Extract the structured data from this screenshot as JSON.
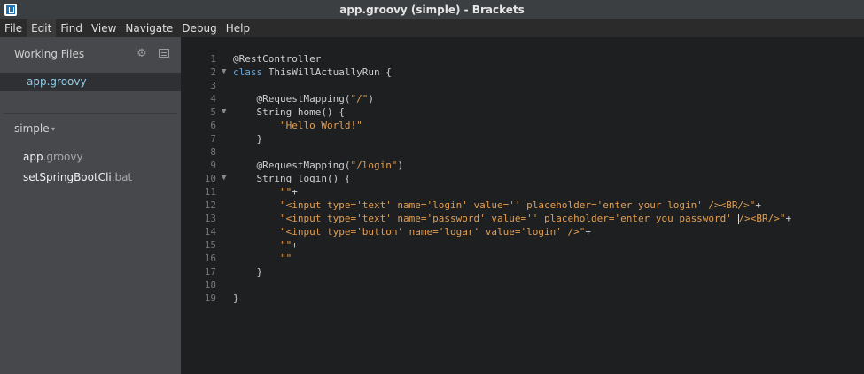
{
  "window": {
    "title": "app.groovy (simple) - Brackets"
  },
  "menu": [
    "File",
    "Edit",
    "Find",
    "View",
    "Navigate",
    "Debug",
    "Help"
  ],
  "sidebar": {
    "working_files_label": "Working Files",
    "working_file": "app.groovy",
    "project_name": "simple",
    "project_caret": "▾",
    "files": [
      {
        "name": "app",
        "ext": ".groovy"
      },
      {
        "name": "setSpringBootCli",
        "ext": ".bat"
      }
    ]
  },
  "editor": {
    "fold_glyph": "▼",
    "lines": [
      {
        "n": "1",
        "fold": false,
        "segs": [
          {
            "t": "@RestController",
            "c": "plain"
          }
        ]
      },
      {
        "n": "2",
        "fold": true,
        "segs": [
          {
            "t": "class",
            "c": "kw"
          },
          {
            "t": " ThisWillActuallyRun {",
            "c": "plain"
          }
        ]
      },
      {
        "n": "3",
        "fold": false,
        "segs": []
      },
      {
        "n": "4",
        "fold": false,
        "segs": [
          {
            "t": "    @RequestMapping(",
            "c": "plain"
          },
          {
            "t": "\"/\"",
            "c": "str"
          },
          {
            "t": ")",
            "c": "plain"
          }
        ]
      },
      {
        "n": "5",
        "fold": true,
        "segs": [
          {
            "t": "    String home() {",
            "c": "plain"
          }
        ]
      },
      {
        "n": "6",
        "fold": false,
        "segs": [
          {
            "t": "        ",
            "c": "plain"
          },
          {
            "t": "\"Hello World!\"",
            "c": "str"
          }
        ]
      },
      {
        "n": "7",
        "fold": false,
        "segs": [
          {
            "t": "    }",
            "c": "plain"
          }
        ]
      },
      {
        "n": "8",
        "fold": false,
        "segs": []
      },
      {
        "n": "9",
        "fold": false,
        "segs": [
          {
            "t": "    @RequestMapping(",
            "c": "plain"
          },
          {
            "t": "\"/login\"",
            "c": "str"
          },
          {
            "t": ")",
            "c": "plain"
          }
        ]
      },
      {
        "n": "10",
        "fold": true,
        "segs": [
          {
            "t": "    String login() {",
            "c": "plain"
          }
        ]
      },
      {
        "n": "11",
        "fold": false,
        "segs": [
          {
            "t": "        ",
            "c": "plain"
          },
          {
            "t": "\"\"",
            "c": "str"
          },
          {
            "t": "+",
            "c": "plain"
          }
        ]
      },
      {
        "n": "12",
        "fold": false,
        "segs": [
          {
            "t": "        ",
            "c": "plain"
          },
          {
            "t": "\"<input type='text' name='login' value='' placeholder='enter your login' /><BR/>\"",
            "c": "str"
          },
          {
            "t": "+",
            "c": "plain"
          }
        ]
      },
      {
        "n": "13",
        "fold": false,
        "segs": [
          {
            "t": "        ",
            "c": "plain"
          },
          {
            "t": "\"<input type='text' name='password' value='' placeholder='enter you password' ",
            "c": "str"
          },
          {
            "t": "",
            "c": "cursor"
          },
          {
            "t": "/><BR/>\"",
            "c": "str"
          },
          {
            "t": "+",
            "c": "plain"
          }
        ]
      },
      {
        "n": "14",
        "fold": false,
        "segs": [
          {
            "t": "        ",
            "c": "plain"
          },
          {
            "t": "\"<input type='button' name='logar' value='login' />\"",
            "c": "str"
          },
          {
            "t": "+",
            "c": "plain"
          }
        ]
      },
      {
        "n": "15",
        "fold": false,
        "segs": [
          {
            "t": "        ",
            "c": "plain"
          },
          {
            "t": "\"\"",
            "c": "str"
          },
          {
            "t": "+",
            "c": "plain"
          }
        ]
      },
      {
        "n": "16",
        "fold": false,
        "segs": [
          {
            "t": "        ",
            "c": "plain"
          },
          {
            "t": "\"\"",
            "c": "str"
          }
        ]
      },
      {
        "n": "17",
        "fold": false,
        "segs": [
          {
            "t": "    }",
            "c": "plain"
          }
        ]
      },
      {
        "n": "18",
        "fold": false,
        "segs": []
      },
      {
        "n": "19",
        "fold": false,
        "segs": [
          {
            "t": "}",
            "c": "plain"
          }
        ]
      }
    ]
  },
  "colors": {
    "keyword": "#6da8dc",
    "string": "#e29e52",
    "text": "#cfcfcf",
    "sidebar": "#47484b",
    "editor_bg": "#1d1f21"
  },
  "icons": {
    "app": "brackets-logo-icon",
    "settings": "gear-icon",
    "split": "split-view-icon"
  }
}
